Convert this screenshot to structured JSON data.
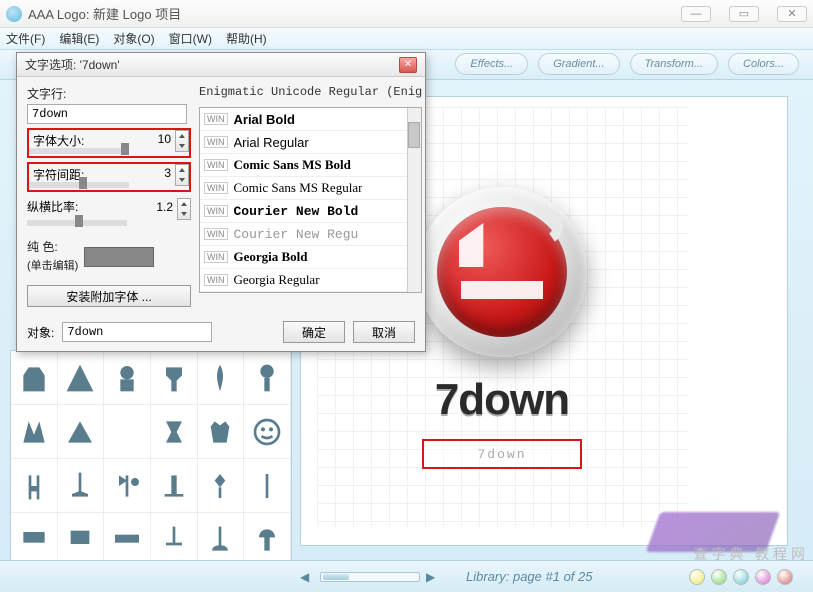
{
  "window": {
    "title": "AAA Logo: 新建 Logo 项目"
  },
  "menu": {
    "file": "文件(F)",
    "edit": "编辑(E)",
    "object": "对象(O)",
    "window": "窗口(W)",
    "help": "帮助(H)"
  },
  "toolbar": {
    "effects": "Effects...",
    "gradient": "Gradient...",
    "transform": "Transform...",
    "colors": "Colors..."
  },
  "dialog": {
    "title": "文字选项: '7down'",
    "text_row_label": "文字行:",
    "text_value": "7down",
    "font_size_label": "字体大小:",
    "font_size_value": "10",
    "char_spacing_label": "字符间距:",
    "char_spacing_value": "3",
    "aspect_label": "纵横比率:",
    "aspect_value": "1.2",
    "color_label": "纯   色:",
    "color_hint": "(单击编辑)",
    "install_btn": "安装附加字体 ...",
    "font_preview": "Enigmatic Unicode Regular (Enig",
    "fonts": [
      {
        "tag": "WIN",
        "name": "Arial Bold",
        "style": "font-weight:bold;font-family:Arial"
      },
      {
        "tag": "WIN",
        "name": "Arial Regular",
        "style": "font-family:Arial"
      },
      {
        "tag": "WIN",
        "name": "Comic Sans MS Bold",
        "style": "font-weight:bold;font-family:'Comic Sans MS',cursive"
      },
      {
        "tag": "WIN",
        "name": "Comic Sans MS Regular",
        "style": "font-family:'Comic Sans MS',cursive"
      },
      {
        "tag": "WIN",
        "name": "Courier New Bold",
        "style": "font-weight:bold;font-family:'Courier New',monospace"
      },
      {
        "tag": "WIN",
        "name": "Courier New Regu",
        "style": "font-family:'Courier New',monospace;color:#999"
      },
      {
        "tag": "WIN",
        "name": "Georgia Bold",
        "style": "font-weight:bold;font-family:Georgia,serif"
      },
      {
        "tag": "WIN",
        "name": "Georgia Regular",
        "style": "font-family:Georgia,serif"
      }
    ],
    "object_label": "对象:",
    "object_value": "7down",
    "ok": "确定",
    "cancel": "取消"
  },
  "canvas": {
    "logo_text": "7down",
    "sel_text": "7down"
  },
  "footer": {
    "library_text": "Library: page #1 of 25",
    "dot_colors": [
      "#e8ec5a",
      "#7ed66a",
      "#66c7d1",
      "#d66ad1",
      "#d66a6a"
    ]
  },
  "watermark": {
    "big": "查字典   教程网"
  }
}
